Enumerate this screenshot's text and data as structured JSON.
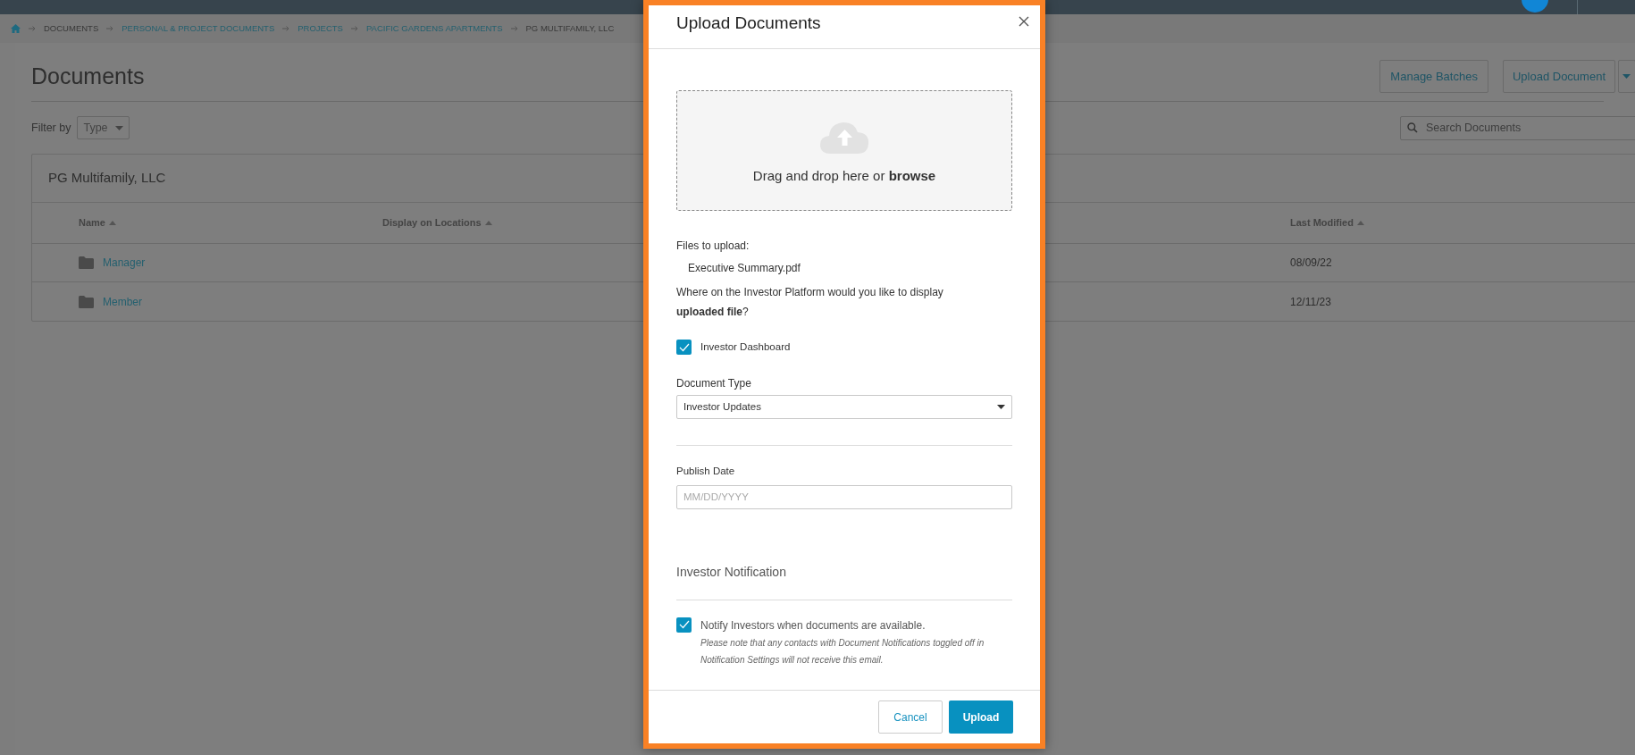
{
  "breadcrumbs": [
    {
      "label": "DOCUMENTS",
      "link": false
    },
    {
      "label": "PERSONAL & PROJECT DOCUMENTS",
      "link": true
    },
    {
      "label": "PROJECTS",
      "link": true
    },
    {
      "label": "PACIFIC GARDENS APARTMENTS",
      "link": true
    },
    {
      "label": "PG MULTIFAMILY, LLC",
      "link": false
    }
  ],
  "page": {
    "title": "Documents",
    "buttons": [
      "Manage Batches",
      "Upload Document"
    ],
    "filter_label": "Filter by",
    "filter_value": "Type",
    "search": {
      "placeholder": "Search Documents"
    }
  },
  "table": {
    "title": "PG Multifamily, LLC",
    "columns": [
      "Name",
      "Display on Locations",
      "Last Modified"
    ],
    "rows": [
      {
        "name": "Manager",
        "last_modified": "08/09/22"
      },
      {
        "name": "Member",
        "last_modified": "12/11/23"
      }
    ]
  },
  "modal": {
    "title": "Upload Documents",
    "dropzone": "Drag and drop here or **browse**",
    "files_label": "Files to upload:",
    "files": [
      "Executive Summary.pdf"
    ],
    "question": "Where on the Investor Platform would you like to display **uploaded file**?",
    "locations": [
      {
        "label": "Investor Dashboard",
        "checked": true
      }
    ],
    "document_type": {
      "label": "Document Type",
      "value": "Investor Updates"
    },
    "publish_date": {
      "label": "Publish Date",
      "placeholder": "MM/DD/YYYY"
    },
    "notification": {
      "heading": "Investor Notification",
      "label": "Notify Investors when documents are available.",
      "checked": true,
      "note": "Please note that any contacts with Document Notifications toggled off in Notification Settings will not receive this email."
    },
    "buttons": [
      {
        "label": "Cancel",
        "kind": "secondary"
      },
      {
        "label": "Upload",
        "kind": "primary"
      }
    ]
  }
}
